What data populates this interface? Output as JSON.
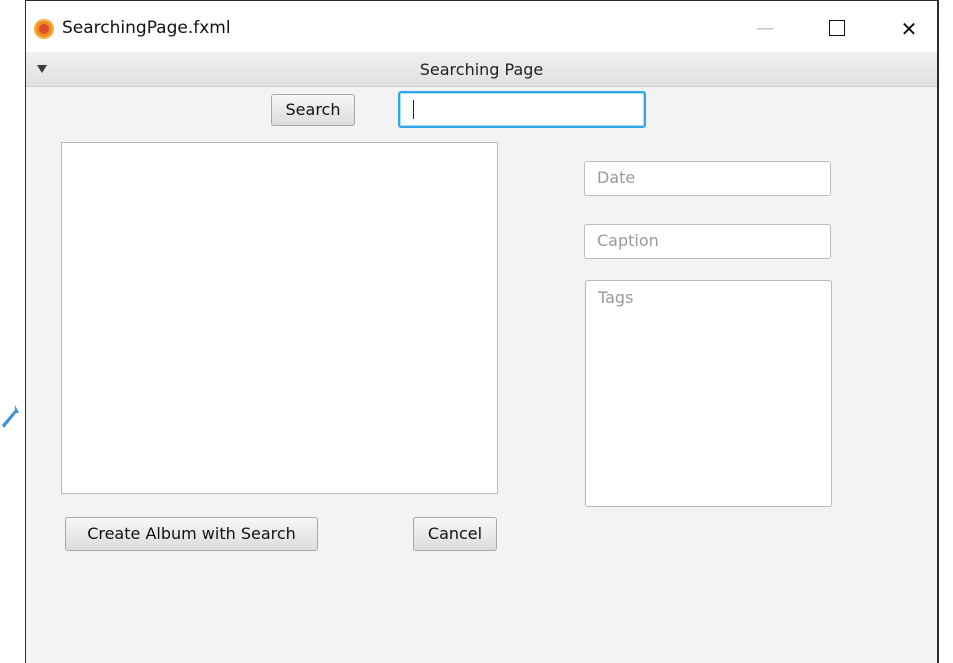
{
  "window": {
    "title": "SearchingPage.fxml",
    "controls": {
      "minimize_glyph": "—",
      "close_glyph": "✕"
    }
  },
  "header": {
    "title": "Searching Page"
  },
  "search": {
    "button_label": "Search",
    "query_value": ""
  },
  "details": {
    "date_placeholder": "Date",
    "caption_placeholder": "Caption",
    "tags_placeholder": "Tags"
  },
  "actions": {
    "create_album_label": "Create Album with Search",
    "cancel_label": "Cancel"
  },
  "colors": {
    "background": "#f3f3f3",
    "focus_border": "#2fa6e8",
    "app_icon": "#f08a24"
  },
  "icons": {
    "app": "fxml-app-icon",
    "collapse": "triangle-down-icon",
    "cursor": "pointer-arrow-icon"
  }
}
